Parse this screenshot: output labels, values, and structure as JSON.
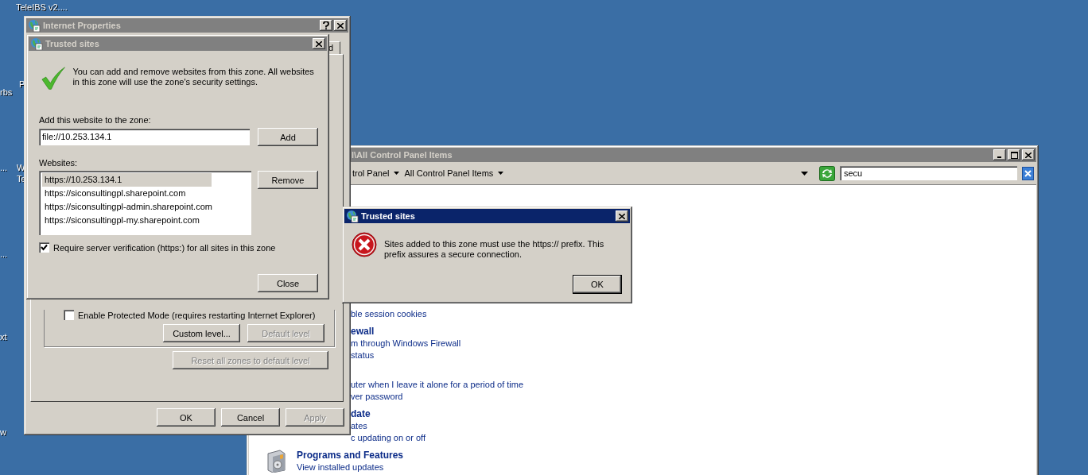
{
  "desktop_labels": [
    "TeleIBS v2....",
    "P",
    "rbs",
    "...",
    "W",
    "Te",
    "...",
    "xt",
    "w"
  ],
  "control_panel": {
    "title": "l\\All Control Panel Items",
    "active": false,
    "breadcrumb": [
      "trol Panel",
      "All Control Panel Items"
    ],
    "search": {
      "value": "secu"
    },
    "groups": [
      {
        "links": [
          "ble session cookies"
        ]
      },
      {
        "heading": "ewall",
        "links": [
          "m through Windows Firewall",
          "status"
        ]
      },
      {
        "links": [
          "uter when I leave it alone for a period of time",
          "ver password"
        ]
      },
      {
        "heading": "date",
        "links": [
          "ates",
          "c updating on or off"
        ]
      },
      {
        "heading": "Programs and Features",
        "links": [
          "View installed updates"
        ]
      }
    ]
  },
  "internet_properties": {
    "title": "Internet Properties",
    "active": false,
    "tab": "d",
    "protected_mode": {
      "label": "Enable Protected Mode (requires restarting Internet Explorer)",
      "checked": false
    },
    "level_buttons": [
      {
        "label": "Custom level...",
        "disabled": false
      },
      {
        "label": "Default level",
        "disabled": true
      }
    ],
    "reset_button": {
      "label": "Reset all zones to default level",
      "disabled": true
    },
    "footer_buttons": [
      {
        "label": "OK",
        "disabled": false
      },
      {
        "label": "Cancel",
        "disabled": false
      },
      {
        "label": "Apply",
        "disabled": true
      }
    ]
  },
  "trusted_sites": {
    "title": "Trusted sites",
    "active": false,
    "message": "You can add and remove websites from this zone. All websites in this zone will use the zone's security settings.",
    "add_label": "Add this website to the zone:",
    "add_value": "file://10.253.134.1",
    "add_button": "Add",
    "websites_label": "Websites:",
    "websites": [
      {
        "url": "https://10.253.134.1",
        "selected": true
      },
      {
        "url": "https://siconsultingpl.sharepoint.com",
        "selected": false
      },
      {
        "url": "https://siconsultingpl-admin.sharepoint.com",
        "selected": false
      },
      {
        "url": "https://siconsultingpl-my.sharepoint.com",
        "selected": false
      }
    ],
    "remove_button": "Remove",
    "require_https": {
      "label": "Require server verification (https:) for all sites in this zone",
      "checked": true
    },
    "close_button": "Close"
  },
  "error_dialog": {
    "title": "Trusted sites",
    "active": true,
    "message": "Sites added to this zone must use the  https:// prefix. This prefix assures a secure connection.",
    "ok_button": "OK"
  }
}
